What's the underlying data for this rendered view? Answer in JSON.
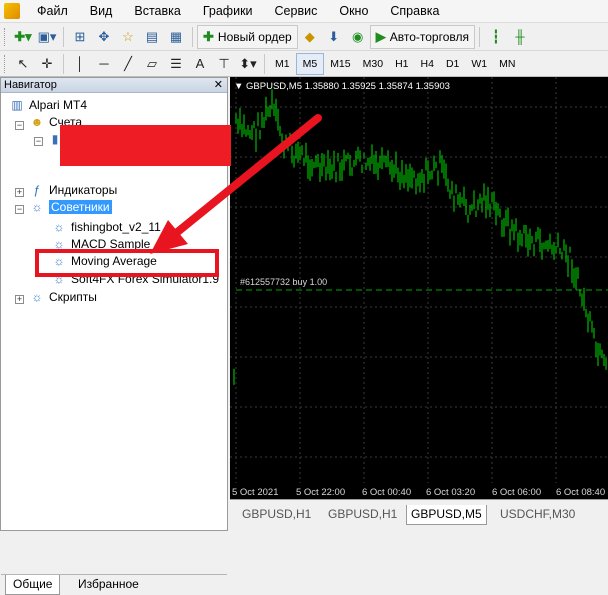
{
  "menu": {
    "items": [
      "Файл",
      "Вид",
      "Вставка",
      "Графики",
      "Сервис",
      "Окно",
      "Справка"
    ]
  },
  "toolbar": {
    "new_order_label": "Новый ордер",
    "autotrading_label": "Авто-торговля",
    "timeframes": [
      "M1",
      "M5",
      "M15",
      "M30",
      "H1",
      "H4",
      "D1",
      "W1",
      "MN"
    ],
    "active_timeframe": "M5"
  },
  "navigator": {
    "title": "Навигатор",
    "root": "Alpari MT4",
    "accounts": "Счета",
    "indicators": "Индикаторы",
    "experts": "Советники",
    "experts_items": [
      "fishingbot_v2_11",
      "MACD Sample",
      "Moving Average",
      "Soft4FX Forex Simulator1.9"
    ],
    "scripts": "Скрипты",
    "tabs": [
      "Общие",
      "Избранное"
    ]
  },
  "chart": {
    "header": "GBPUSD,M5  1.35880 1.35925 1.35874 1.35903",
    "order_label": "#612557732 buy 1.00",
    "x_labels": [
      "5 Oct 2021",
      "5 Oct 22:00",
      "6 Oct 00:40",
      "6 Oct 03:20",
      "6 Oct 06:00",
      "6 Oct 08:40"
    ],
    "tabs": [
      "GBPUSD,H1",
      "GBPUSD,H1",
      "GBPUSD,M5",
      "USDCHF,M30"
    ],
    "active_tab": 2,
    "colors": {
      "candle": "#00dd00",
      "background": "#000000",
      "order_line": "#00aa00",
      "grid": "#3a3a3a"
    }
  },
  "annotations": {
    "arrow_color": "#e8141f",
    "highlight_color": "#e8141f",
    "redaction_color": "#ee1c25"
  }
}
